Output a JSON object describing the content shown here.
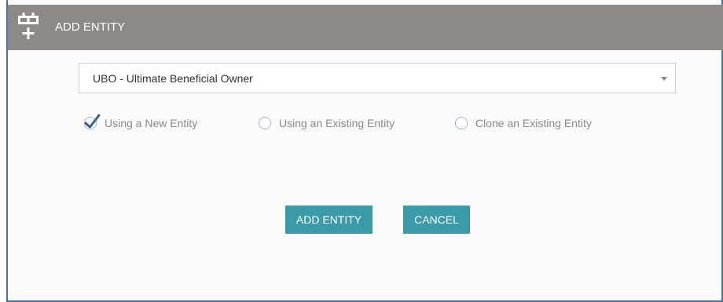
{
  "dialog": {
    "title": "ADD ENTITY",
    "header_icon": "entity-add-icon"
  },
  "entity_type_select": {
    "value": "UBO - Ultimate Beneficial Owner",
    "caret_icon": "chevron-down-icon"
  },
  "options": [
    {
      "label": "Using a New Entity",
      "selected": true
    },
    {
      "label": "Using an Existing Entity",
      "selected": false
    },
    {
      "label": "Clone an Existing Entity",
      "selected": false
    }
  ],
  "buttons": {
    "add_label": "ADD ENTITY",
    "cancel_label": "CANCEL"
  },
  "colors": {
    "header_bg": "#8e8987",
    "button_bg": "#3a9aa8",
    "border": "#4a70a6"
  }
}
